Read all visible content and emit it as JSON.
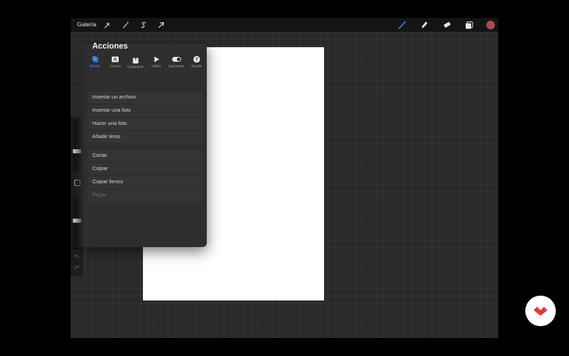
{
  "topbar": {
    "gallery_label": "Galería",
    "left_icons": [
      "wrench-icon",
      "magic-wand-icon",
      "selection-icon",
      "transform-arrow-icon"
    ],
    "right_icons": [
      "brush-icon",
      "smudge-icon",
      "eraser-icon",
      "layers-icon"
    ],
    "active_tool_color": "#2f7bf5",
    "current_color": "#b14848"
  },
  "actions_panel": {
    "title": "Acciones",
    "tabs": [
      {
        "label": "Añadir",
        "icon": "add-icon",
        "active": true
      },
      {
        "label": "Lienzo",
        "icon": "canvas-icon",
        "active": false
      },
      {
        "label": "Compartir",
        "icon": "share-icon",
        "active": false
      },
      {
        "label": "Vídeo",
        "icon": "video-play-icon",
        "active": false
      },
      {
        "label": "Opciones",
        "icon": "toggle-icon",
        "active": false
      },
      {
        "label": "Ayuda",
        "icon": "help-icon",
        "active": false
      }
    ],
    "group1": [
      {
        "label": "Insertar un archivo"
      },
      {
        "label": "Insertar una foto"
      },
      {
        "label": "Hacer una foto"
      },
      {
        "label": "Añadir texto"
      }
    ],
    "group2": [
      {
        "label": "Cortar",
        "enabled": true
      },
      {
        "label": "Copiar",
        "enabled": true
      },
      {
        "label": "Copiar lienzo",
        "enabled": true
      },
      {
        "label": "Pegar",
        "enabled": false
      }
    ]
  },
  "sidebar": {
    "brush_size_level": 0.64,
    "opacity_level": 0.45
  },
  "colors": {
    "accent": "#3d8bff",
    "background": "#2a2a2a",
    "logo_red": "#e03a3a"
  }
}
